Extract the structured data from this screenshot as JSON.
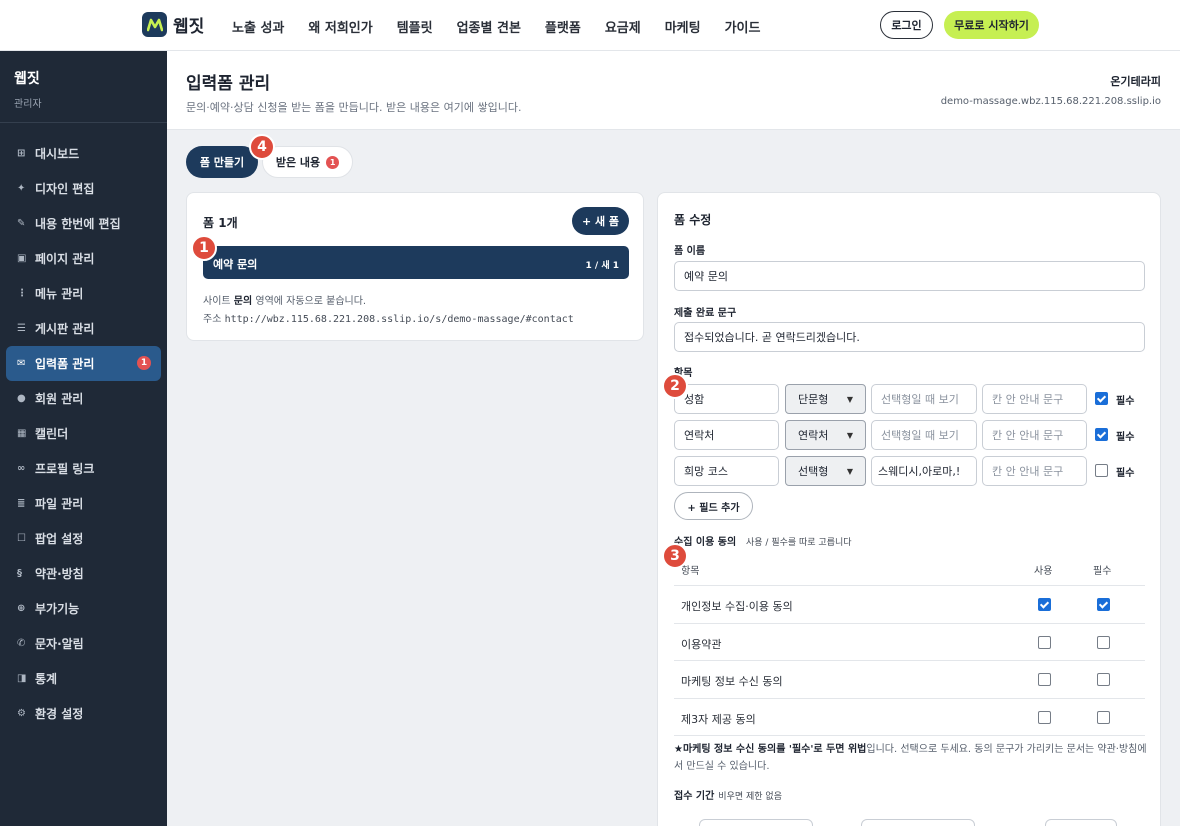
{
  "brand": {
    "name": "웹짓"
  },
  "topnav": {
    "items": [
      "노출 성과",
      "왜 저희인가",
      "템플릿",
      "업종별 견본",
      "플랫폼",
      "요금제",
      "마케팅",
      "가이드"
    ],
    "login": "로그인",
    "start": "무료로 시작하기"
  },
  "sidebar": {
    "name": "웹짓",
    "role": "관리자",
    "items": [
      {
        "icon": "grid-icon",
        "glyph": "⊞",
        "label": "대시보드"
      },
      {
        "icon": "sparkle-icon",
        "glyph": "✦",
        "label": "디자인 편집"
      },
      {
        "icon": "pencil-icon",
        "glyph": "✎",
        "label": "내용 한번에 편집"
      },
      {
        "icon": "page-icon",
        "glyph": "▣",
        "label": "페이지 관리"
      },
      {
        "icon": "more-icon",
        "glyph": "⋮",
        "label": "메뉴 관리"
      },
      {
        "icon": "list-icon",
        "glyph": "☰",
        "label": "게시판 관리"
      },
      {
        "icon": "mail-icon",
        "glyph": "✉",
        "label": "입력폼 관리",
        "badge": "1"
      },
      {
        "icon": "user-icon",
        "glyph": "●",
        "label": "회원 관리"
      },
      {
        "icon": "calendar-icon",
        "glyph": "▦",
        "label": "캘린더"
      },
      {
        "icon": "link-icon",
        "glyph": "∞",
        "label": "프로필 링크"
      },
      {
        "icon": "files-icon",
        "glyph": "≣",
        "label": "파일 관리"
      },
      {
        "icon": "popup-icon",
        "glyph": "☐",
        "label": "팝업 설정"
      },
      {
        "icon": "section-icon",
        "glyph": "§",
        "label": "약관·방침"
      },
      {
        "icon": "plus-circle-icon",
        "glyph": "⊕",
        "label": "부가기능"
      },
      {
        "icon": "phone-icon",
        "glyph": "✆",
        "label": "문자·알림"
      },
      {
        "icon": "stats-icon",
        "glyph": "◨",
        "label": "통계"
      },
      {
        "icon": "gear-icon",
        "glyph": "⚙",
        "label": "환경 설정"
      }
    ]
  },
  "header": {
    "title": "입력폼 관리",
    "subtitle": "문의·예약·상담 신청을 받는 폼을 만듭니다. 받은 내용은 여기에 쌓입니다.",
    "site_name": "온기테라피",
    "site_url": "demo-massage.wbz.115.68.221.208.sslip.io"
  },
  "tabs": {
    "build": "폼 만들기",
    "received": "받은 내용",
    "received_badge": "1"
  },
  "markers": [
    "1",
    "2",
    "3",
    "4"
  ],
  "form_list": {
    "title": "폼 1개",
    "new_button": "+ 새 폼",
    "item_name": "예약 문의",
    "item_count": "1 / 새 1",
    "note_prefix": "사이트 ",
    "note_bold": "문의",
    "note_suffix": " 영역에 자동으로 붙습니다.",
    "addr_label": "주소 ",
    "addr_url": "http://wbz.115.68.221.208.sslip.io/s/demo-massage/#contact"
  },
  "editor": {
    "title": "폼 수정",
    "name_label": "폼 이름",
    "name_value": "예약 문의",
    "done_label": "제출 완료 문구",
    "done_value": "접수되었습니다. 곧 연락드리겠습니다.",
    "fields_label": "항목",
    "fields": [
      {
        "name": "성함",
        "type": "단문형",
        "options": "",
        "hint": "",
        "required": true
      },
      {
        "name": "연락처",
        "type": "연락처",
        "options": "",
        "hint": "",
        "required": true
      },
      {
        "name": "희망 코스",
        "type": "선택형",
        "options": "스웨디시,아로마,!",
        "hint": "",
        "required": false
      }
    ],
    "options_placeholder": "선택형일 때 보기",
    "hint_placeholder": "칸 안 안내 문구",
    "required_label": "필수",
    "add_field": "+ 필드 추가",
    "consent_label": "수집 이용 동의",
    "consent_hint": "사용 / 필수를 따로 고릅니다",
    "consent_head": {
      "item": "항목",
      "use": "사용",
      "required": "필수"
    },
    "consents": [
      {
        "label": "개인정보 수집·이용 동의",
        "use": true,
        "required": true
      },
      {
        "label": "이용약관",
        "use": false,
        "required": false
      },
      {
        "label": "마케팅 정보 수신 동의",
        "use": false,
        "required": false
      },
      {
        "label": "제3자 제공 동의",
        "use": false,
        "required": false
      }
    ],
    "warn_bold": "★마케팅 정보 수신 동의를 '필수'로 두면 위법",
    "warn_rest": "입니다. 선택으로 두세요. 동의 문구가 가리키는 문서는 약관·방침에서 만드실 수 있습니다.",
    "period_label": "접수 기간",
    "period_hint": "비우면 제한 없음"
  },
  "colors": {
    "navy": "#1d3a5c",
    "accent": "#c6ef52",
    "badge": "#e35252",
    "sidebar": "#1f2937"
  }
}
